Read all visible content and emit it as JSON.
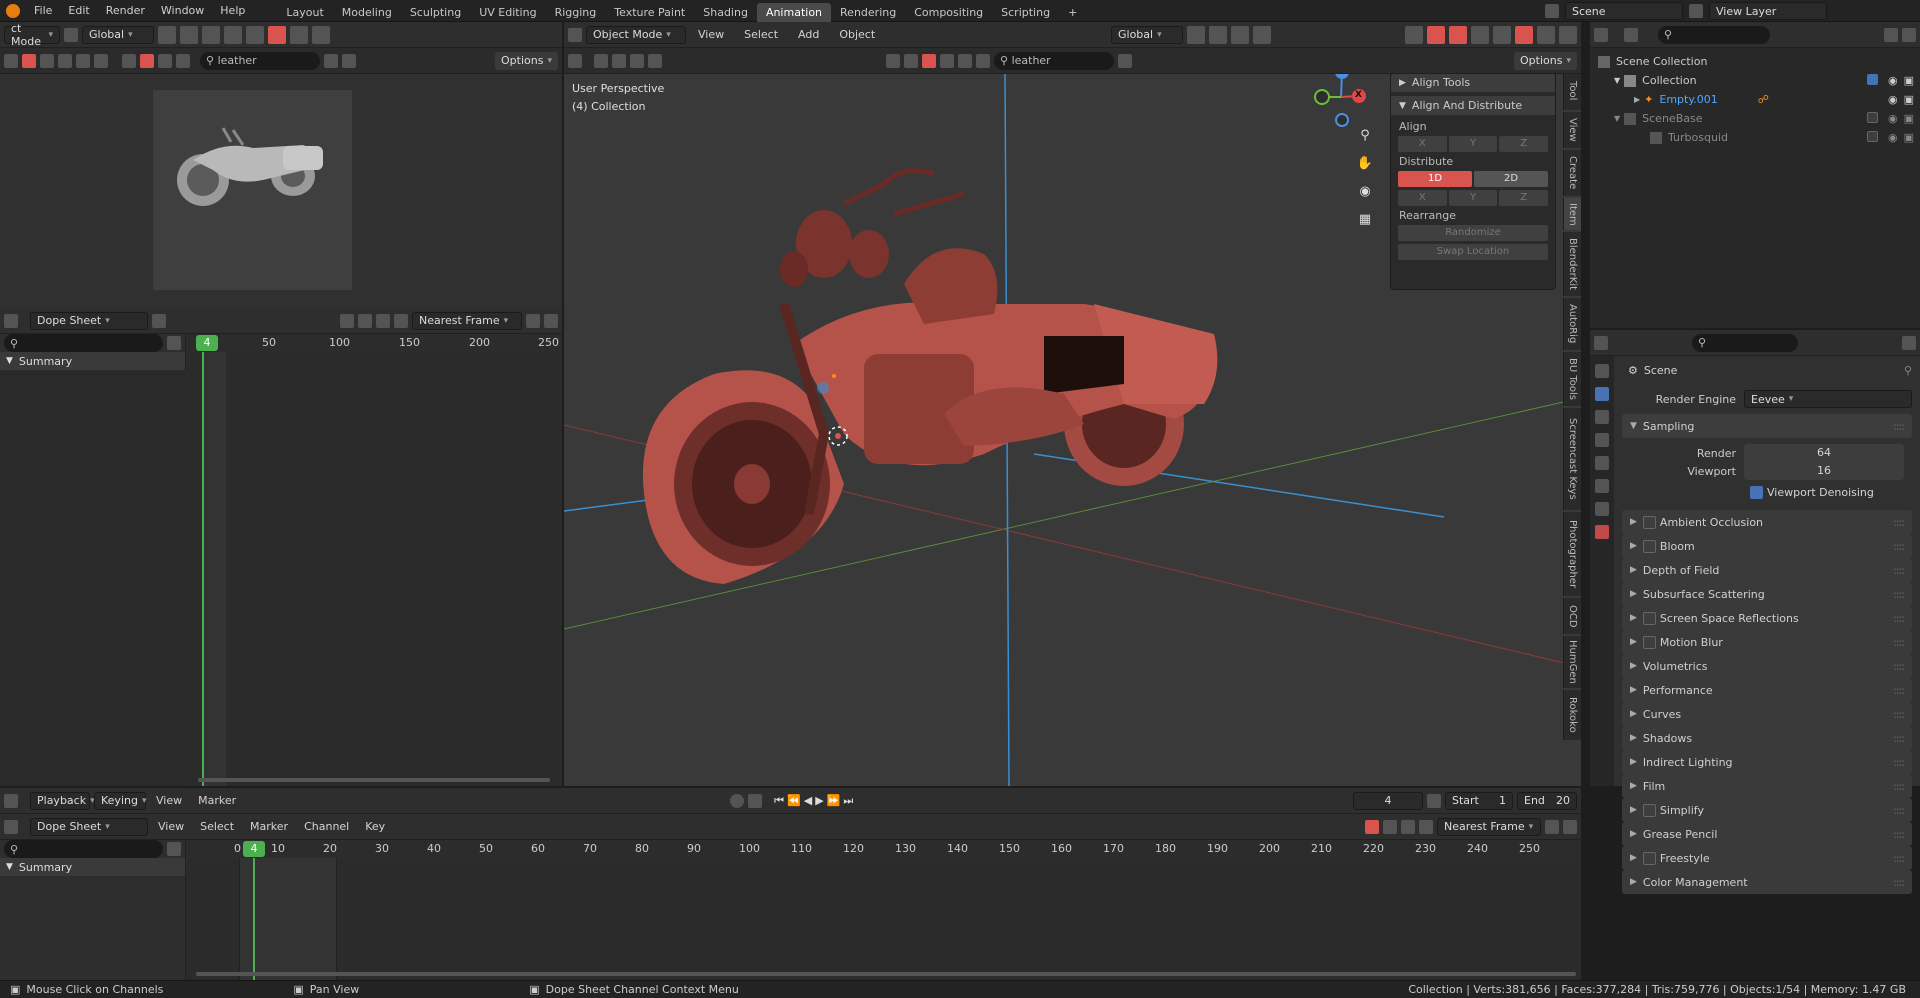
{
  "topbar": {
    "menus": [
      "File",
      "Edit",
      "Render",
      "Window",
      "Help"
    ],
    "workspaces": [
      "Layout",
      "Modeling",
      "Sculpting",
      "UV Editing",
      "Rigging",
      "Texture Paint",
      "Shading",
      "Animation",
      "Rendering",
      "Compositing",
      "Scripting"
    ],
    "active_workspace": "Animation",
    "add_tab": "+",
    "scene": "Scene",
    "view_layer": "View Layer"
  },
  "left_header": {
    "mode": "ct Mode",
    "orientation": "Global",
    "search": "leather",
    "options": "Options"
  },
  "dopesheet_top": {
    "editor": "Dope Sheet",
    "snap": "Nearest Frame",
    "current_frame": "4",
    "ruler": [
      "50",
      "100",
      "150",
      "200",
      "250"
    ],
    "channel": "Summary"
  },
  "viewport": {
    "mode": "Object Mode",
    "menus": [
      "View",
      "Select",
      "Add",
      "Object"
    ],
    "orientation": "Global",
    "search": "leather",
    "options": "Options",
    "info_line1": "User Perspective",
    "info_line2": "(4) Collection",
    "gizmo": {
      "x": "X",
      "y": "Y",
      "z": "Z"
    }
  },
  "npanel": {
    "align_tools": "Align Tools",
    "align_distribute": "Align And Distribute",
    "align": "Align",
    "distribute": "Distribute",
    "rearrange": "Rearrange",
    "axes": [
      "X",
      "Y",
      "Z"
    ],
    "d1": "1D",
    "d2": "2D",
    "randomize": "Randomize",
    "swap": "Swap Location",
    "tabs": [
      "Tool",
      "View",
      "Create",
      "Item",
      "BlenderKit",
      "AutoRig",
      "BU Tools",
      "Screencast Keys",
      "Photographer",
      "OCD",
      "HumGen",
      "Rokoko"
    ]
  },
  "outliner": {
    "rows": [
      {
        "label": "Scene Collection",
        "indent": 0
      },
      {
        "label": "Collection",
        "indent": 1
      },
      {
        "label": "Empty.001",
        "indent": 2,
        "highlight": true
      },
      {
        "label": "SceneBase",
        "indent": 1,
        "dim": true
      },
      {
        "label": "Turbosquid",
        "indent": 2,
        "dim": true
      }
    ]
  },
  "properties": {
    "scene": "Scene",
    "engine_label": "Render Engine",
    "engine": "Eevee",
    "sampling": "Sampling",
    "render_label": "Render",
    "render_val": "64",
    "viewport_label": "Viewport",
    "viewport_val": "16",
    "denoise": "Viewport Denoising",
    "sections": [
      {
        "label": "Ambient Occlusion",
        "cb": true
      },
      {
        "label": "Bloom",
        "cb": true
      },
      {
        "label": "Depth of Field",
        "cb": false
      },
      {
        "label": "Subsurface Scattering",
        "cb": false
      },
      {
        "label": "Screen Space Reflections",
        "cb": true
      },
      {
        "label": "Motion Blur",
        "cb": true
      },
      {
        "label": "Volumetrics",
        "cb": false
      },
      {
        "label": "Performance",
        "cb": false
      },
      {
        "label": "Curves",
        "cb": false
      },
      {
        "label": "Shadows",
        "cb": false
      },
      {
        "label": "Indirect Lighting",
        "cb": false
      },
      {
        "label": "Film",
        "cb": false
      },
      {
        "label": "Simplify",
        "cb": true
      },
      {
        "label": "Grease Pencil",
        "cb": false
      },
      {
        "label": "Freestyle",
        "cb": true
      },
      {
        "label": "Color Management",
        "cb": false
      }
    ]
  },
  "timeline": {
    "menus": [
      "Playback",
      "Keying",
      "View",
      "Marker"
    ],
    "frame": "4",
    "start_label": "Start",
    "start": "1",
    "end_label": "End",
    "end": "20"
  },
  "dopesheet_bottom": {
    "editor": "Dope Sheet",
    "menus": [
      "View",
      "Select",
      "Marker",
      "Channel",
      "Key"
    ],
    "snap": "Nearest Frame",
    "ruler": [
      "0",
      "10",
      "20",
      "30",
      "40",
      "50",
      "60",
      "70",
      "80",
      "90",
      "100",
      "110",
      "120",
      "130",
      "140",
      "150",
      "160",
      "170",
      "180",
      "190",
      "200",
      "210",
      "220",
      "230",
      "240",
      "250"
    ],
    "current_frame": "4",
    "channel": "Summary"
  },
  "status": {
    "left1": "Mouse Click on Channels",
    "left2": "Pan View",
    "left3": "Dope Sheet Channel Context Menu",
    "right": "Collection | Verts:381,656 | Faces:377,284 | Tris:759,776 | Objects:1/54 | Memory: 1.47 GB"
  },
  "colors": {
    "accent": "#4772b3",
    "active_red": "#d9534f",
    "frame_green": "#4caf50",
    "axis_x": "#e04848",
    "axis_y": "#6bbf3a",
    "axis_z": "#4a8fe0",
    "model": "#b5534a"
  }
}
